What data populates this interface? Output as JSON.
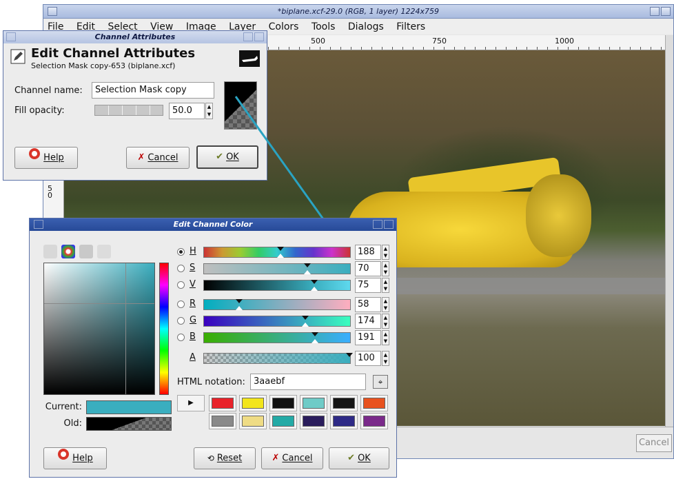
{
  "main_window": {
    "title": "*biplane.xcf-29.0 (RGB, 1 layer) 1224x759",
    "menu": [
      "File",
      "Edit",
      "Select",
      "View",
      "Image",
      "Layer",
      "Colors",
      "Tools",
      "Dialogs",
      "Filters"
    ],
    "ruler_h": [
      "500",
      "750",
      "1000"
    ],
    "ruler_v": "5\n0",
    "cancel_label": "Cancel"
  },
  "channel_attributes": {
    "window_title": "Channel Attributes",
    "heading": "Edit Channel Attributes",
    "subheading": "Selection Mask copy-653 (biplane.xcf)",
    "name_label": "Channel name:",
    "name_value": "Selection Mask copy",
    "opacity_label": "Fill opacity:",
    "opacity_value": "50.0",
    "help_label": "Help",
    "cancel_label": "Cancel",
    "ok_label": "OK"
  },
  "edit_channel_color": {
    "window_title": "Edit Channel Color",
    "channels": [
      {
        "label": "H",
        "value": "188",
        "selected": true
      },
      {
        "label": "S",
        "value": "70",
        "selected": false
      },
      {
        "label": "V",
        "value": "75",
        "selected": false
      },
      {
        "label": "R",
        "value": "58",
        "selected": false
      },
      {
        "label": "G",
        "value": "174",
        "selected": false
      },
      {
        "label": "B",
        "value": "191",
        "selected": false
      },
      {
        "label": "A",
        "value": "100",
        "selected": false
      }
    ],
    "html_notation_label": "HTML notation:",
    "html_notation_value": "3aaebf",
    "current_label": "Current:",
    "old_label": "Old:",
    "current_color": "#3aaebf",
    "palette_row1": [
      "#e8222a",
      "#f2e51c",
      "#111111",
      "#6fcbc7",
      "#151515",
      "#e8521f"
    ],
    "palette_row2": [
      "#8a8a8a",
      "#efdc85",
      "#23aaa6",
      "#2a1d5c",
      "#2e2a86",
      "#7a2a8a"
    ],
    "help_label": "Help",
    "reset_label": "Reset",
    "cancel_label": "Cancel",
    "ok_label": "OK"
  }
}
